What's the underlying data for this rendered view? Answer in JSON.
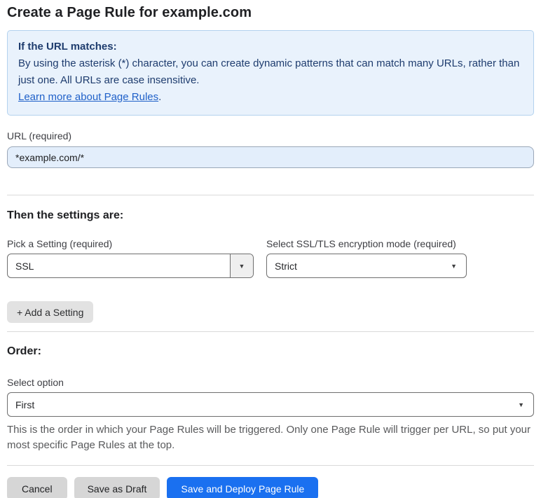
{
  "page": {
    "title": "Create a Page Rule for example.com"
  },
  "info_box": {
    "heading": "If the URL matches:",
    "body": "By using the asterisk (*) character, you can create dynamic patterns that can match many URLs, rather than just one. All URLs are case insensitive.",
    "link": "Learn more about Page Rules",
    "link_suffix": "."
  },
  "url_field": {
    "label": "URL (required)",
    "value": "*example.com/*"
  },
  "settings_section": {
    "heading": "Then the settings are:",
    "setting_picker": {
      "label": "Pick a Setting (required)",
      "value": "SSL"
    },
    "ssl_mode_picker": {
      "label": "Select SSL/TLS encryption mode (required)",
      "value": "Strict"
    },
    "add_setting_label": "+ Add a Setting"
  },
  "order_section": {
    "heading": "Order:",
    "select_label": "Select option",
    "value": "First",
    "help_text": "This is the order in which your Page Rules will be triggered. Only one Page Rule will trigger per URL, so put your most specific Page Rules at the top."
  },
  "footer": {
    "cancel_label": "Cancel",
    "save_draft_label": "Save as Draft",
    "save_deploy_label": "Save and Deploy Page Rule"
  },
  "icons": {
    "dropdown_arrow": "▼"
  },
  "colors": {
    "info_bg": "#e9f2fc",
    "info_border": "#b3d2ee",
    "info_text": "#1e3c6e",
    "link": "#2061c9",
    "url_input_bg": "#e3eefb",
    "primary_button": "#1a70f0",
    "secondary_button": "#d6d6d6"
  }
}
